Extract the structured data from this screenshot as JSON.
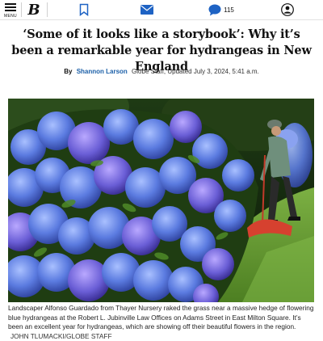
{
  "nav": {
    "menu_label": "MENU",
    "logo": "B",
    "comment_count": "115"
  },
  "article": {
    "headline": "‘Some of it looks like a storybook’: Why it’s been a remarkable year for hydrangeas in New England",
    "byline_prefix": "By",
    "author": "Shannon Larson",
    "byline_meta": "Globe Staff, Updated July 3, 2024, 5:41 a.m.",
    "caption": "Landscaper Alfonso Guardado from Thayer Nursery raked the grass near a massive hedge of flowering blue hydrangeas at the Robert L. Jubinville Law Offices on Adams Street in East Milton Square. It’s been an excellent year for hydrangeas, which are showing off their beautiful flowers in the region.",
    "photo_credit": "JOHN TLUMACKI/GLOBE STAFF"
  },
  "colors": {
    "link_blue": "#1b5fa8",
    "icon_blue": "#1e63c4",
    "hydrangea_blue": "#5b7be0",
    "grass": "#6fa63a"
  }
}
